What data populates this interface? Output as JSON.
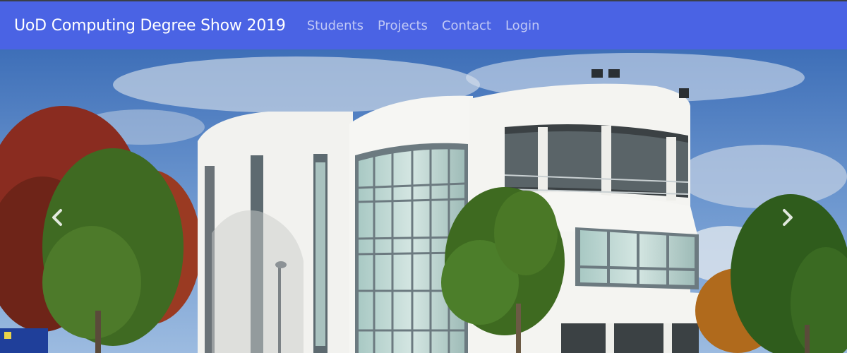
{
  "navbar": {
    "brand": "UoD Computing Degree Show 2019",
    "links": [
      {
        "label": "Students"
      },
      {
        "label": "Projects"
      },
      {
        "label": "Contact"
      },
      {
        "label": "Login"
      }
    ]
  },
  "carousel": {
    "prev_icon": "chevron-left-icon",
    "next_icon": "chevron-right-icon",
    "slide_image": "university-building-photo"
  },
  "colors": {
    "navbar_bg": "#4a63e4",
    "brand_text": "#ffffff",
    "link_text": "rgba(255,255,255,0.65)"
  }
}
